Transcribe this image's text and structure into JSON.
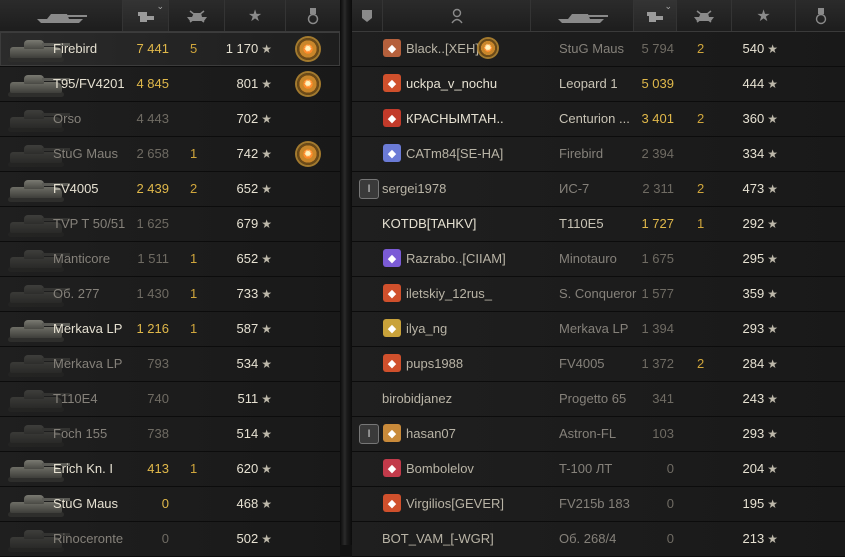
{
  "left_header": {
    "cols": [
      {
        "id": "tank",
        "icon": "tank-icon"
      },
      {
        "id": "damage",
        "icon": "damage-icon",
        "sorted": true
      },
      {
        "id": "kills",
        "icon": "destroyed-tank-icon"
      },
      {
        "id": "score",
        "icon": "star-icon",
        "glyph": "★"
      },
      {
        "id": "medal",
        "icon": "medal-icon"
      }
    ]
  },
  "right_header": {
    "cols": [
      {
        "id": "platoon",
        "icon": "platoon-icon"
      },
      {
        "id": "player",
        "icon": "player-icon"
      },
      {
        "id": "tank",
        "icon": "tank-icon"
      },
      {
        "id": "damage",
        "icon": "damage-icon",
        "sorted": true
      },
      {
        "id": "kills",
        "icon": "destroyed-tank-icon"
      },
      {
        "id": "score",
        "icon": "star-icon",
        "glyph": "★"
      },
      {
        "id": "medal",
        "icon": "medal-icon"
      }
    ]
  },
  "left_rows": [
    {
      "tank": "Firebird",
      "damage": "7 441",
      "kills": "5",
      "score": "1 170",
      "medal": true,
      "self": true,
      "alive": true
    },
    {
      "tank": "T95/FV4201",
      "damage": "4 845",
      "kills": "",
      "score": "801",
      "medal": true,
      "alive": true
    },
    {
      "tank": "Orso",
      "damage": "4 443",
      "kills": "",
      "score": "702",
      "alive": false
    },
    {
      "tank": "StuG Maus",
      "damage": "2 658",
      "kills": "1",
      "score": "742",
      "medal": true,
      "alive": false
    },
    {
      "tank": "FV4005",
      "damage": "2 439",
      "kills": "2",
      "score": "652",
      "alive": true
    },
    {
      "tank": "TVP T 50/51",
      "damage": "1 625",
      "kills": "",
      "score": "679",
      "alive": false
    },
    {
      "tank": "Manticore",
      "damage": "1 511",
      "kills": "1",
      "score": "652",
      "alive": false
    },
    {
      "tank": "Об. 277",
      "damage": "1 430",
      "kills": "1",
      "score": "733",
      "alive": false
    },
    {
      "tank": "Merkava LP",
      "damage": "1 216",
      "kills": "1",
      "score": "587",
      "alive": true
    },
    {
      "tank": "Merkava LP",
      "damage": "793",
      "kills": "",
      "score": "534",
      "alive": false
    },
    {
      "tank": "T110E4",
      "damage": "740",
      "kills": "",
      "score": "511",
      "alive": false
    },
    {
      "tank": "Foch 155",
      "damage": "738",
      "kills": "",
      "score": "514",
      "alive": false
    },
    {
      "tank": "Erich Kn. I",
      "damage": "413",
      "kills": "1",
      "score": "620",
      "alive": true
    },
    {
      "tank": "StuG Maus",
      "damage": "0",
      "kills": "",
      "score": "468",
      "alive": true
    },
    {
      "tank": "Rinoceronte",
      "damage": "0",
      "kills": "",
      "score": "502",
      "alive": false
    }
  ],
  "right_rows": [
    {
      "player": "Black..[XEH]",
      "clan": "clan-emblem-icon",
      "clan_color": "#b5603c",
      "tank": "StuG Maus",
      "damage": "5 794",
      "kills": "2",
      "score": "540",
      "medal": "rank-badge-icon",
      "alive": false
    },
    {
      "player": "uckpa_v_nochu",
      "clan": "diamond-emblem-icon",
      "clan_color": "#d0502c",
      "tank": "Leopard 1",
      "damage": "5 039",
      "kills": "",
      "score": "444",
      "alive": true
    },
    {
      "player": "КРАСНЫМТАН..",
      "clan": "flower-emblem-icon",
      "clan_color": "#c23a2a",
      "tank": "Centurion ...",
      "damage": "3 401",
      "kills": "2",
      "score": "360",
      "alive": true
    },
    {
      "player": "CATm84[SE-HA]",
      "clan": "snowflake-emblem-icon",
      "clan_color": "#6b7bd6",
      "tank": "Firebird",
      "damage": "2 394",
      "kills": "",
      "score": "334",
      "alive": false
    },
    {
      "player": "sergei1978",
      "clan": "platoon-badge-icon",
      "clan_color": "#7a7a7a",
      "tank": "ИС-7",
      "damage": "2 311",
      "kills": "2",
      "score": "473",
      "alive": false,
      "platoon": true
    },
    {
      "player": "KOTDB[TAHKV]",
      "clan": "",
      "clan_color": "",
      "tank": "T110E5",
      "damage": "1 727",
      "kills": "1",
      "score": "292",
      "alive": true
    },
    {
      "player": "Razrabo..[CIIAM]",
      "clan": "sword-emblem-icon",
      "clan_color": "#7b5bd6",
      "tank": "Minotauro",
      "damage": "1 675",
      "kills": "",
      "score": "295",
      "alive": false
    },
    {
      "player": "iletskiy_12rus_",
      "clan": "diamond-emblem-icon",
      "clan_color": "#d0502c",
      "tank": "S. Conqueror",
      "damage": "1 577",
      "kills": "",
      "score": "359",
      "alive": false
    },
    {
      "player": "ilya_ng",
      "clan": "shield-emblem-icon",
      "clan_color": "#c9a23a",
      "tank": "Merkava LP",
      "damage": "1 394",
      "kills": "",
      "score": "293",
      "alive": false
    },
    {
      "player": "pups1988",
      "clan": "diamond-emblem-icon",
      "clan_color": "#d0502c",
      "tank": "FV4005",
      "damage": "1 372",
      "kills": "2",
      "score": "284",
      "alive": false
    },
    {
      "player": "birobidjanez",
      "clan": "",
      "clan_color": "",
      "tank": "Progetto 65",
      "damage": "341",
      "kills": "",
      "score": "243",
      "alive": false
    },
    {
      "player": "hasan07",
      "clan": "crown-emblem-icon",
      "clan_color": "#c98a3a",
      "tank": "Astron-FL",
      "damage": "103",
      "kills": "",
      "score": "293",
      "alive": false,
      "platoon": true
    },
    {
      "player": "Bombolelov",
      "clan": "eye-emblem-icon",
      "clan_color": "#c23a4a",
      "tank": "T-100 ЛТ",
      "damage": "0",
      "kills": "",
      "score": "204",
      "alive": false
    },
    {
      "player": "Virgilios[GEVER]",
      "clan": "diamond-emblem-icon",
      "clan_color": "#d0502c",
      "tank": "FV215b 183",
      "damage": "0",
      "kills": "",
      "score": "195",
      "alive": false
    },
    {
      "player": "BOT_VAM_[-WGR]",
      "clan": "",
      "clan_color": "",
      "tank": "Об. 268/4",
      "damage": "0",
      "kills": "",
      "score": "213",
      "alive": false
    }
  ]
}
